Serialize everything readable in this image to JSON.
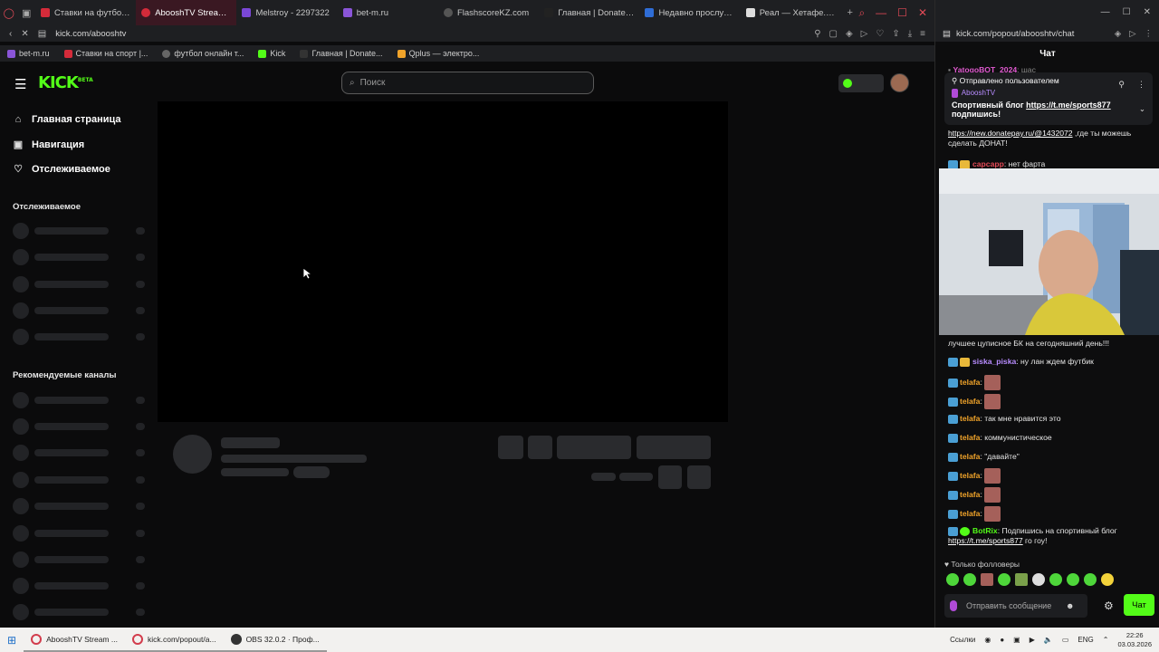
{
  "browser": {
    "tabs": [
      {
        "label": "Ставки на футбол с",
        "color": "#d42b3a"
      },
      {
        "label": "AbooshTV Stream - Watc",
        "color": "#d42b3a",
        "active": true
      },
      {
        "label": "Melstroy - 2297322",
        "color": "#7a47d6"
      },
      {
        "label": "bet-m.ru",
        "color": "#8a55d8"
      },
      {
        "label": "FlashscoreKZ.com",
        "color": "#555"
      },
      {
        "label": "Главная | DonatePa",
        "color": "#222"
      },
      {
        "label": "Недавно прослуша",
        "color": "#2f6dd6"
      },
      {
        "label": "Реал — Хетафе. Об",
        "color": "#ddd"
      }
    ],
    "url": "kick.com/abooshtv",
    "bookmarks": [
      {
        "label": "bet-m.ru",
        "color": "#8a55d8"
      },
      {
        "label": "Ставки на спорт |...",
        "color": "#d42b3a"
      },
      {
        "label": "футбол онлайн т...",
        "color": "#666"
      },
      {
        "label": "Kick",
        "color": "#53fc18"
      },
      {
        "label": "Главная | Donate...",
        "color": "#333"
      },
      {
        "label": "Qplus — электро...",
        "color": "#f0a32a"
      }
    ]
  },
  "kick": {
    "logo": "KICK",
    "logo_badge": "BETA",
    "search_placeholder": "Поиск",
    "nav": [
      {
        "label": "Главная страница",
        "icon": "home-icon"
      },
      {
        "label": "Навигация",
        "icon": "compass-icon"
      },
      {
        "label": "Отслеживаемое",
        "icon": "heart-icon"
      }
    ],
    "following_title": "Отслеживаемое",
    "recommended_title": "Рекомендуемые каналы"
  },
  "chat": {
    "url": "kick.com/popout/abooshtv/chat",
    "title": "Чат",
    "pinned_header": "Отправлено пользователем",
    "pinned_user": "AbooshTV",
    "pinned_text": "Спортивный блог",
    "pinned_link": "https://t.me/sports877",
    "pinned_tail": "подпишись!",
    "top_link": "https://new.donatepay.ru/@1432072",
    "top_text": " ,где ты можешь сделать ДОНАТ!",
    "msg_kapcapp_user": "capcapp",
    "msg_kapcapp_text": ": нет фарта",
    "hidden_line": "лучшее цуписное БК на сегодняшний день!!!",
    "messages": [
      {
        "user": "siska_piska",
        "color": "#b88cff",
        "text": ": ну лан ждем футбик"
      },
      {
        "user": "telafa",
        "color": "#f0a32a",
        "text": ":"
      },
      {
        "user": "telafa",
        "color": "#f0a32a",
        "text": ":"
      },
      {
        "user": "telafa",
        "color": "#f0a32a",
        "text": ": так мне нравится это"
      },
      {
        "user": "telafa",
        "color": "#f0a32a",
        "text": ": коммунистическое"
      },
      {
        "user": "telafa",
        "color": "#f0a32a",
        "text": ": \"давайте\""
      },
      {
        "user": "telafa",
        "color": "#f0a32a",
        "text": ":"
      },
      {
        "user": "telafa",
        "color": "#f0a32a",
        "text": ":"
      },
      {
        "user": "telafa",
        "color": "#f0a32a",
        "text": ":"
      }
    ],
    "botrix_user": "BotRix",
    "botrix_text": ": Подпишись на спортивный блог",
    "botrix_link": "https://t.me/sports877",
    "botrix_tail": " го гоу!",
    "followers_only": "Только фолловеры",
    "input_placeholder": "Отправить сообщение",
    "send_label": "Чат"
  },
  "taskbar": {
    "items": [
      "AbooshTV Stream ...",
      "kick.com/popout/a...",
      "OBS 32.0.2 · Проф..."
    ],
    "links": "Ссылки",
    "lang": "ENG",
    "time": "22:26",
    "date": "03.03.2026"
  }
}
